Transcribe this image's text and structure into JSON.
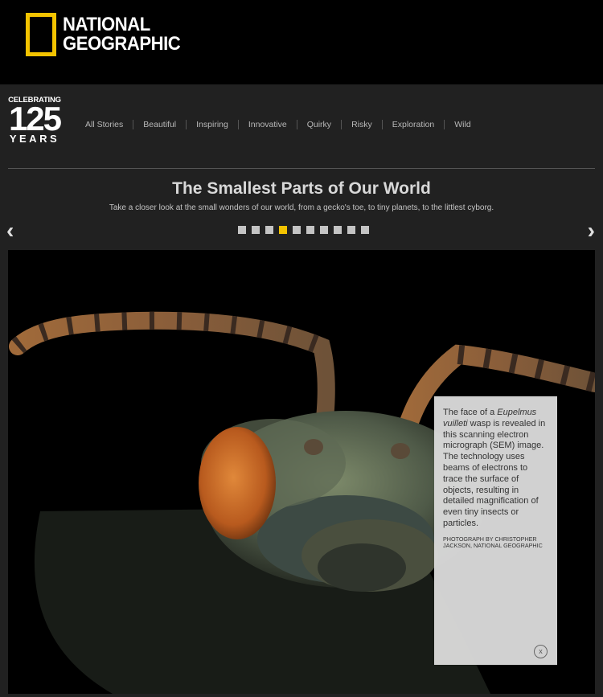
{
  "brand": {
    "line1": "NATIONAL",
    "line2": "GEOGRAPHIC",
    "accent": "#f3c300"
  },
  "badge": {
    "top": "CELEBRATING",
    "number": "125",
    "bottom": "YEARS"
  },
  "nav": {
    "items": [
      "All Stories",
      "Beautiful",
      "Inspiring",
      "Innovative",
      "Quirky",
      "Risky",
      "Exploration",
      "Wild"
    ]
  },
  "gallery": {
    "title": "The Smallest Parts of Our World",
    "subtitle": "Take a closer look at the small wonders of our world, from a gecko's toe, to tiny planets, to the littlest cyborg.",
    "prev_icon": "chevron-left-icon",
    "next_icon": "chevron-right-icon",
    "prev_glyph": "‹",
    "next_glyph": "›",
    "slide_count": 10,
    "active_index": 3
  },
  "caption": {
    "pre": "The face of a ",
    "species": "Eupelmus vuilleti",
    "post": " wasp is revealed in this scanning electron micrograph (SEM) image. The technology uses beams of electrons to trace the surface of objects, resulting in detailed magnification of even tiny insects or particles.",
    "credit": "PHOTOGRAPH BY CHRISTOPHER JACKSON, NATIONAL GEOGRAPHIC",
    "close_label": "x"
  }
}
